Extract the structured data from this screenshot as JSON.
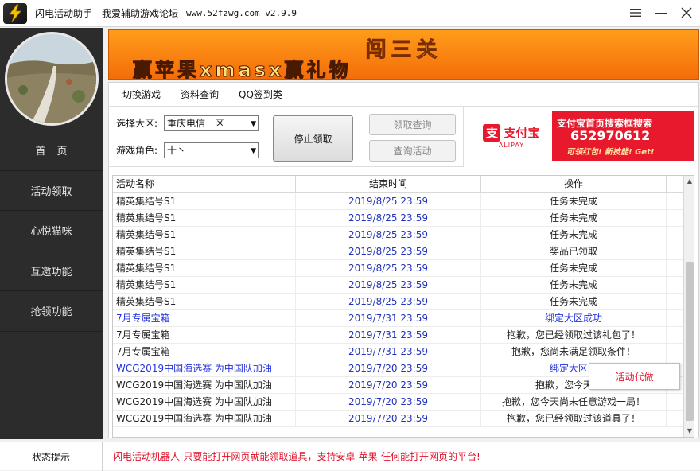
{
  "window": {
    "title": "闪电活动助手 - 我爱辅助游戏论坛",
    "url_version": "www.52fzwg.com v2.9.9"
  },
  "sidebar": {
    "items": [
      {
        "label": "首页"
      },
      {
        "label": "活动领取"
      },
      {
        "label": "心悦猫咪"
      },
      {
        "label": "互邀功能"
      },
      {
        "label": "抢领功能"
      }
    ]
  },
  "banner": {
    "top_text": "闯三关",
    "bottom_text": "赢苹果xmasx赢礼物"
  },
  "tabs": [
    "切换游戏",
    "资料查询",
    "QQ签到类"
  ],
  "controls": {
    "region_label": "选择大区:",
    "region_value": "重庆电信一区",
    "role_label": "游戏角色:",
    "role_value": "十丶",
    "stop_button": "停止领取",
    "claim_query_button": "领取查询",
    "query_activity_button": "查询活动"
  },
  "ad": {
    "logo": "支付宝",
    "logo_sub": "ALIPAY",
    "line1": "支付宝首页搜索框搜索",
    "line2": "652970612",
    "line3": "可领红包! 新技能! Get!"
  },
  "table": {
    "columns": [
      "活动名称",
      "结束时间",
      "操作"
    ],
    "rows": [
      {
        "name": "精英集结号S1",
        "end": "2019/8/25 23:59",
        "status": "任务未完成",
        "highlight": false
      },
      {
        "name": "精英集结号S1",
        "end": "2019/8/25 23:59",
        "status": "任务未完成",
        "highlight": false
      },
      {
        "name": "精英集结号S1",
        "end": "2019/8/25 23:59",
        "status": "任务未完成",
        "highlight": false
      },
      {
        "name": "精英集结号S1",
        "end": "2019/8/25 23:59",
        "status": "奖品已领取",
        "highlight": false
      },
      {
        "name": "精英集结号S1",
        "end": "2019/8/25 23:59",
        "status": "任务未完成",
        "highlight": false
      },
      {
        "name": "精英集结号S1",
        "end": "2019/8/25 23:59",
        "status": "任务未完成",
        "highlight": false
      },
      {
        "name": "精英集结号S1",
        "end": "2019/8/25 23:59",
        "status": "任务未完成",
        "highlight": false
      },
      {
        "name": "7月专属宝箱",
        "end": "2019/7/31 23:59",
        "status": "绑定大区成功",
        "highlight": true
      },
      {
        "name": "7月专属宝箱",
        "end": "2019/7/31 23:59",
        "status": "抱歉，您已经领取过该礼包了！",
        "highlight": false
      },
      {
        "name": "7月专属宝箱",
        "end": "2019/7/31 23:59",
        "status": "抱歉，您尚未满足领取条件！",
        "highlight": false
      },
      {
        "name": "WCG2019中国海选赛 为中国队加油",
        "end": "2019/7/20 23:59",
        "status": "绑定大区成",
        "highlight": true
      },
      {
        "name": "WCG2019中国海选赛 为中国队加油",
        "end": "2019/7/20 23:59",
        "status": "抱歉，您今天已经",
        "highlight": false
      },
      {
        "name": "WCG2019中国海选赛 为中国队加油",
        "end": "2019/7/20 23:59",
        "status": "抱歉，您今天尚未任意游戏一局！",
        "highlight": false
      },
      {
        "name": "WCG2019中国海选赛 为中国队加油",
        "end": "2019/7/20 23:59",
        "status": "抱歉，您已经领取过该道具了！",
        "highlight": false
      }
    ]
  },
  "tooltip": {
    "label": "活动代做"
  },
  "status": {
    "label": "状态提示",
    "message": "闪电活动机器人-只要能打开网页就能领取道具，支持安卓-苹果-任何能打开网页的平台!"
  }
}
